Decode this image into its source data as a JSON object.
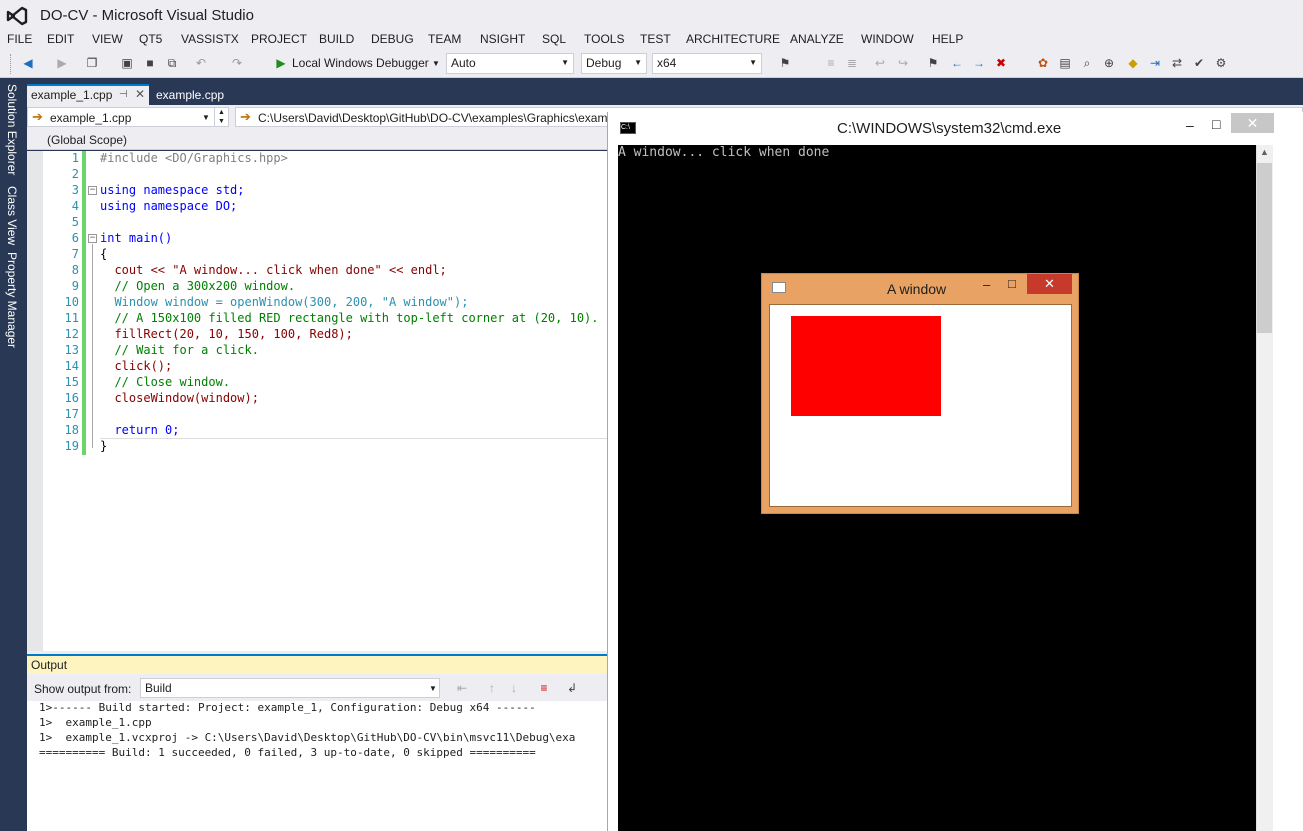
{
  "window": {
    "title": "DO-CV - Microsoft Visual Studio"
  },
  "menu": [
    "FILE",
    "EDIT",
    "VIEW",
    "QT5",
    "VASSISTX",
    "PROJECT",
    "BUILD",
    "DEBUG",
    "TEAM",
    "NSIGHT",
    "SQL",
    "TOOLS",
    "TEST",
    "ARCHITECTURE",
    "ANALYZE",
    "WINDOW",
    "HELP"
  ],
  "toolbar": {
    "debugger_label": "Local Windows Debugger",
    "solution_platform": "Auto",
    "configuration": "Debug",
    "platform": "x64"
  },
  "side_tabs": [
    "Solution Explorer",
    "Class View",
    "Property Manager"
  ],
  "tabs": [
    {
      "label": "example_1.cpp",
      "active": true
    },
    {
      "label": "example.cpp",
      "active": false
    }
  ],
  "navbar": {
    "file": "example_1.cpp",
    "path": "C:\\Users\\David\\Desktop\\GitHub\\DO-CV\\examples\\Graphics\\exam"
  },
  "scope": "(Global Scope)",
  "code_lines": [
    {
      "n": "1",
      "t": "#include <DO/Graphics.hpp>"
    },
    {
      "n": "2",
      "t": ""
    },
    {
      "n": "3",
      "t": "using namespace std;"
    },
    {
      "n": "4",
      "t": "using namespace DO;"
    },
    {
      "n": "5",
      "t": ""
    },
    {
      "n": "6",
      "t": "int main()"
    },
    {
      "n": "7",
      "t": "{"
    },
    {
      "n": "8",
      "t": "  cout << \"A window... click when done\" << endl;"
    },
    {
      "n": "9",
      "t": "  // Open a 300x200 window."
    },
    {
      "n": "10",
      "t": "  Window window = openWindow(300, 200, \"A window\");"
    },
    {
      "n": "11",
      "t": "  // A 150x100 filled RED rectangle with top-left corner at (20, 10)."
    },
    {
      "n": "12",
      "t": "  fillRect(20, 10, 150, 100, Red8);"
    },
    {
      "n": "13",
      "t": "  // Wait for a click."
    },
    {
      "n": "14",
      "t": "  click();"
    },
    {
      "n": "15",
      "t": "  // Close window."
    },
    {
      "n": "16",
      "t": "  closeWindow(window);"
    },
    {
      "n": "17",
      "t": ""
    },
    {
      "n": "18",
      "t": "  return 0;"
    },
    {
      "n": "19",
      "t": "}"
    }
  ],
  "output": {
    "title": "Output",
    "show_from_label": "Show output from:",
    "source": "Build",
    "lines": [
      "1>------ Build started: Project: example_1, Configuration: Debug x64 ------",
      "1>  example_1.cpp",
      "1>  example_1.vcxproj -> C:\\Users\\David\\Desktop\\GitHub\\DO-CV\\bin\\msvc11\\Debug\\exa",
      "========== Build: 1 succeeded, 0 failed, 3 up-to-date, 0 skipped =========="
    ]
  },
  "console": {
    "title": "C:\\WINDOWS\\system32\\cmd.exe",
    "text": "A window... click when done"
  },
  "child_window": {
    "title": "A window",
    "canvas_color": "#ffffff",
    "rect_color": "#ff0000",
    "frame_color": "#e8a264"
  },
  "colors": {
    "accent": "#007acc",
    "rail": "#293955",
    "chrome": "#eeeef2"
  }
}
